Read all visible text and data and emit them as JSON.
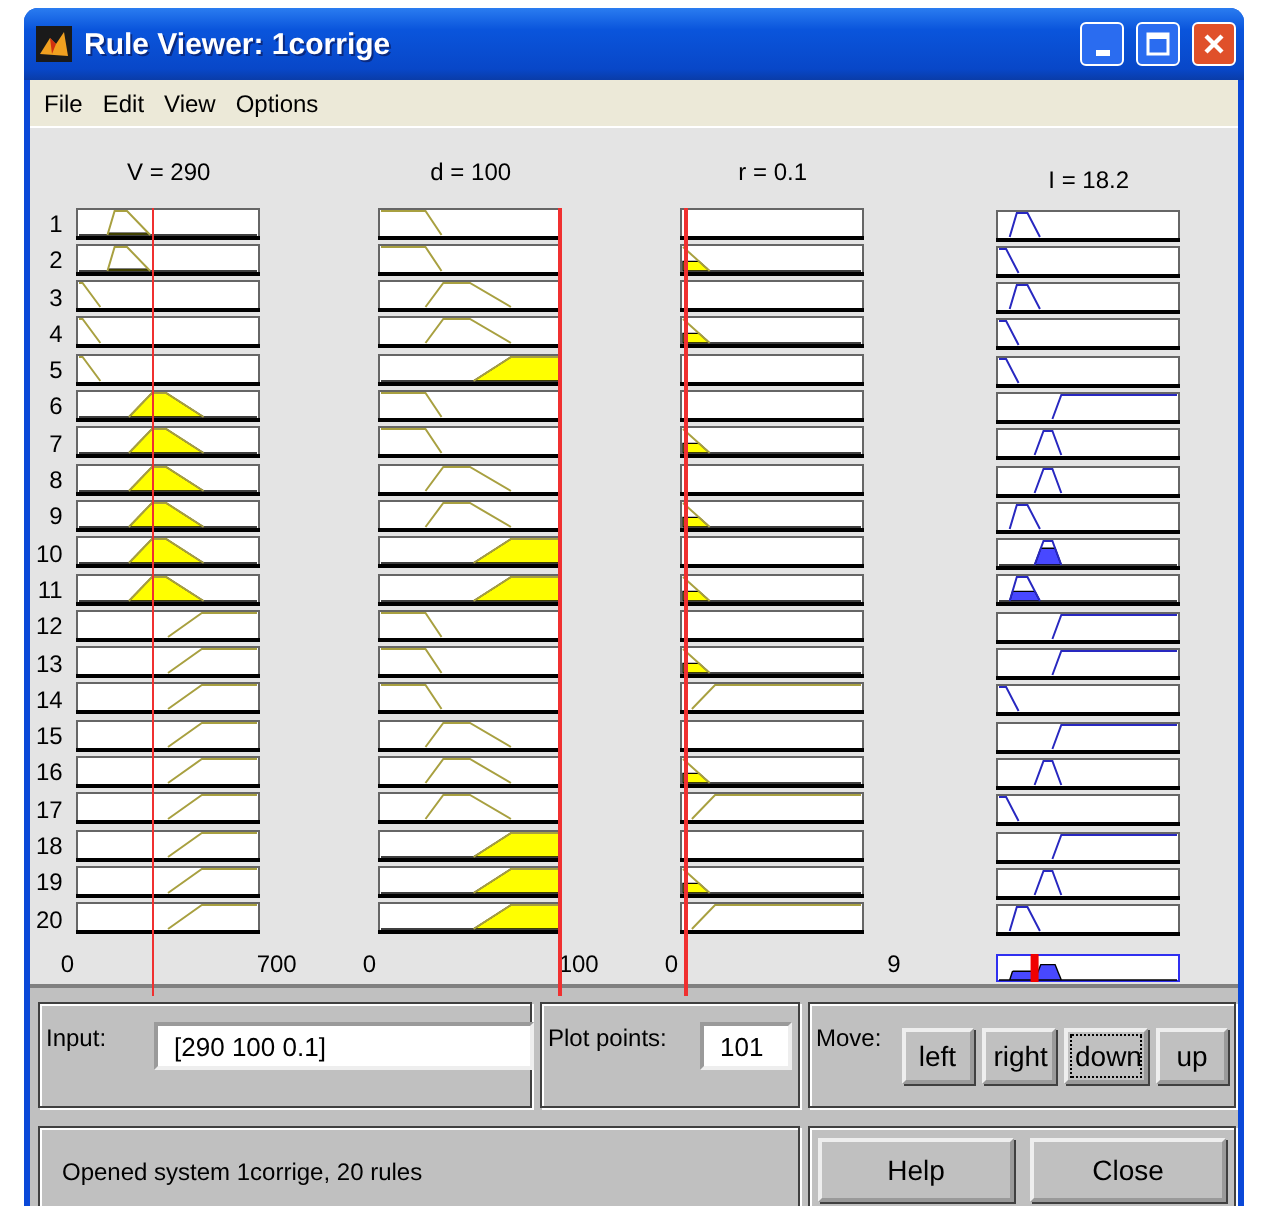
{
  "window": {
    "title": "Rule Viewer: 1corrige"
  },
  "menu": [
    "File",
    "Edit",
    "View",
    "Options"
  ],
  "columns": [
    {
      "label": "V = 290",
      "kind": "input",
      "axis": [
        "0",
        "700"
      ]
    },
    {
      "label": "d = 100",
      "kind": "input",
      "axis": [
        "0",
        "100"
      ]
    },
    {
      "label": "r = 0.1",
      "kind": "input",
      "axis": [
        "0",
        "9"
      ]
    },
    {
      "label": "I = 18.2",
      "kind": "output"
    }
  ],
  "rules": [
    {
      "number": "1",
      "cells": [
        {
          "kind": "lowmid_trace"
        },
        {
          "kind": "low"
        },
        {
          "kind": "none"
        },
        {
          "kind": "lowmid"
        }
      ]
    },
    {
      "number": "2",
      "cells": [
        {
          "kind": "lowmid_trace"
        },
        {
          "kind": "low"
        },
        {
          "kind": "low_partial"
        },
        {
          "kind": "low"
        }
      ]
    },
    {
      "number": "3",
      "cells": [
        {
          "kind": "low"
        },
        {
          "kind": "mid"
        },
        {
          "kind": "none"
        },
        {
          "kind": "lowmid"
        }
      ]
    },
    {
      "number": "4",
      "cells": [
        {
          "kind": "low"
        },
        {
          "kind": "mid"
        },
        {
          "kind": "low_partial"
        },
        {
          "kind": "low"
        }
      ]
    },
    {
      "number": "5",
      "cells": [
        {
          "kind": "low"
        },
        {
          "kind": "high_full"
        },
        {
          "kind": "none"
        },
        {
          "kind": "low"
        }
      ]
    },
    {
      "number": "6",
      "cells": [
        {
          "kind": "mid_full"
        },
        {
          "kind": "low"
        },
        {
          "kind": "none"
        },
        {
          "kind": "high"
        }
      ]
    },
    {
      "number": "7",
      "cells": [
        {
          "kind": "mid_full"
        },
        {
          "kind": "low"
        },
        {
          "kind": "low_partial"
        },
        {
          "kind": "mid"
        }
      ]
    },
    {
      "number": "8",
      "cells": [
        {
          "kind": "mid_full"
        },
        {
          "kind": "mid"
        },
        {
          "kind": "none"
        },
        {
          "kind": "mid"
        }
      ]
    },
    {
      "number": "9",
      "cells": [
        {
          "kind": "mid_full"
        },
        {
          "kind": "mid"
        },
        {
          "kind": "low_partial"
        },
        {
          "kind": "lowmid"
        }
      ]
    },
    {
      "number": "10",
      "cells": [
        {
          "kind": "mid_full"
        },
        {
          "kind": "high_full"
        },
        {
          "kind": "none"
        },
        {
          "kind": "mid_most"
        }
      ]
    },
    {
      "number": "11",
      "cells": [
        {
          "kind": "mid_full"
        },
        {
          "kind": "high_full"
        },
        {
          "kind": "low_partial"
        },
        {
          "kind": "lowmid_partial"
        }
      ]
    },
    {
      "number": "12",
      "cells": [
        {
          "kind": "high"
        },
        {
          "kind": "low"
        },
        {
          "kind": "none"
        },
        {
          "kind": "high"
        }
      ]
    },
    {
      "number": "13",
      "cells": [
        {
          "kind": "high"
        },
        {
          "kind": "low"
        },
        {
          "kind": "low_partial"
        },
        {
          "kind": "high"
        }
      ]
    },
    {
      "number": "14",
      "cells": [
        {
          "kind": "high"
        },
        {
          "kind": "low"
        },
        {
          "kind": "high"
        },
        {
          "kind": "low"
        }
      ]
    },
    {
      "number": "15",
      "cells": [
        {
          "kind": "high"
        },
        {
          "kind": "mid"
        },
        {
          "kind": "none"
        },
        {
          "kind": "high"
        }
      ]
    },
    {
      "number": "16",
      "cells": [
        {
          "kind": "high"
        },
        {
          "kind": "mid"
        },
        {
          "kind": "low_partial"
        },
        {
          "kind": "mid"
        }
      ]
    },
    {
      "number": "17",
      "cells": [
        {
          "kind": "high"
        },
        {
          "kind": "mid"
        },
        {
          "kind": "high"
        },
        {
          "kind": "low"
        }
      ]
    },
    {
      "number": "18",
      "cells": [
        {
          "kind": "high"
        },
        {
          "kind": "high_full"
        },
        {
          "kind": "none"
        },
        {
          "kind": "high"
        }
      ]
    },
    {
      "number": "19",
      "cells": [
        {
          "kind": "high"
        },
        {
          "kind": "high_full"
        },
        {
          "kind": "low_partial"
        },
        {
          "kind": "mid"
        }
      ]
    },
    {
      "number": "20",
      "cells": [
        {
          "kind": "high"
        },
        {
          "kind": "high_full"
        },
        {
          "kind": "high"
        },
        {
          "kind": "lowmid"
        }
      ]
    }
  ],
  "input": {
    "label": "Input:",
    "value": "[290 100 0.1]"
  },
  "plot_points": {
    "label": "Plot points:",
    "value": "101"
  },
  "move": {
    "label": "Move:",
    "buttons": [
      {
        "label": "left",
        "focused": false
      },
      {
        "label": "right",
        "focused": false
      },
      {
        "label": "down",
        "focused": true
      },
      {
        "label": "up",
        "focused": false
      }
    ]
  },
  "status": "Opened system 1corrige, 20 rules",
  "buttons": [
    "Help",
    "Close"
  ]
}
